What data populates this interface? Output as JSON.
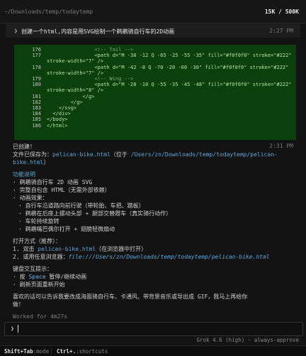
{
  "header": {
    "path": "~/Downloads/temp/todaytemp",
    "tokens": "15K / 500K"
  },
  "user_prompt": {
    "chevron": "❯",
    "text": "创建一个html,内容是用SVG绘制一个鹈鹕骑自行车的2D动画",
    "time": "2:27 PM"
  },
  "code_block": {
    "lines": [
      {
        "n": "176",
        "t": "                <!-- Tail -->",
        "cls": "c-comment"
      },
      {
        "n": "177",
        "t": "                <path d=\"M -38 -12 Q -65 -25 -55 -35\" fill=\"#f0f0f0\" stroke=\"#222\"",
        "cls": "c-tag"
      },
      {
        "n": "",
        "t": "stroke-width=\"7\" />",
        "cls": "c-tag"
      },
      {
        "n": "178",
        "t": "                <path d=\"M -42 -8 Q -70 -20 -60 -30\" fill=\"#f0f0f0\" stroke=\"#222\"",
        "cls": "c-tag"
      },
      {
        "n": "",
        "t": "stroke-width=\"7\" />",
        "cls": "c-tag"
      },
      {
        "n": "179",
        "t": "                <!-- Wing -->",
        "cls": "c-comment"
      },
      {
        "n": "180",
        "t": "                <path d=\"M -28 -10 Q -55 -35 -45 -48\" fill=\"#f0f0f0\" stroke=\"#222\"",
        "cls": "c-tag"
      },
      {
        "n": "",
        "t": "stroke-width=\"8\" />",
        "cls": "c-tag"
      },
      {
        "n": "181",
        "t": "            </g>",
        "cls": "c-tag"
      },
      {
        "n": "182",
        "t": "        </g>",
        "cls": "c-tag"
      },
      {
        "n": "183",
        "t": "    </svg>",
        "cls": "c-tag"
      },
      {
        "n": "184",
        "t": "  </div>",
        "cls": "c-tag"
      },
      {
        "n": "185",
        "t": "</body>",
        "cls": "c-tag"
      },
      {
        "n": "186",
        "t": "</html>",
        "cls": "c-tag"
      }
    ]
  },
  "response": {
    "time": "2:31 PM",
    "created": "已创建！",
    "saved_prefix": "文件已保存为：",
    "filename": "pelican-bike.html",
    "location_prefix": "（位于 ",
    "location_path": "/Users/zn/Downloads/temp/todaytemp/pelican-",
    "location_path_2": "bike.html",
    "location_suffix": "）",
    "features_title": "功能说明",
    "features": [
      "· 鹈鹕骑自行车 2D 动画 SVG",
      "· 完整自包含 HTML（无需外部依赖）",
      "· 动画效果："
    ],
    "effects": [
      "· 自行车沿道路向前行驶（带轮胎、车把、踏板）",
      "· 鹈鹕在后座上摆动头部 + 腿部交替蹬车（真实骑行动作）",
      "· 车轮持续旋转",
      "· 鹈鹕嘴巴偶尔打开 + 翅膀轻微扇动"
    ],
    "open_title": "打开方式（推荐）：",
    "open_1_prefix": "1. 双击 ",
    "open_1_file": "pelican-bike.html",
    "open_1_suffix": "（在浏览器中打开）",
    "open_2_prefix": "2. 或用任意浏览器：",
    "open_2_url": "file:///Users/zn/Downloads/temp/todaytemp/pelican-bike.html",
    "keys_title": "键盘交互提示：",
    "key_1_prefix": "· 按 ",
    "key_1_key": "Space",
    "key_1_suffix": " 暂停/继续动画",
    "key_2": "· 刷新页面重新开始",
    "closing_1": "喜欢的话可以告诉我要改成海面骑自行车、卡通风、带背景音乐或导出成 GIF，我马上再给你",
    "closing_2": "做！",
    "worked": "Worked for 4m27s"
  },
  "input": {
    "caret": "❯",
    "value": ""
  },
  "model": {
    "label": "Grok 4.6 (high)",
    "sep": "·",
    "mode": "always-approve"
  },
  "status": {
    "k1": "Shift+Tab",
    "v1": ":mode",
    "sep": "|",
    "k2": "Ctrl+.",
    "v2": ":shortcuts"
  }
}
